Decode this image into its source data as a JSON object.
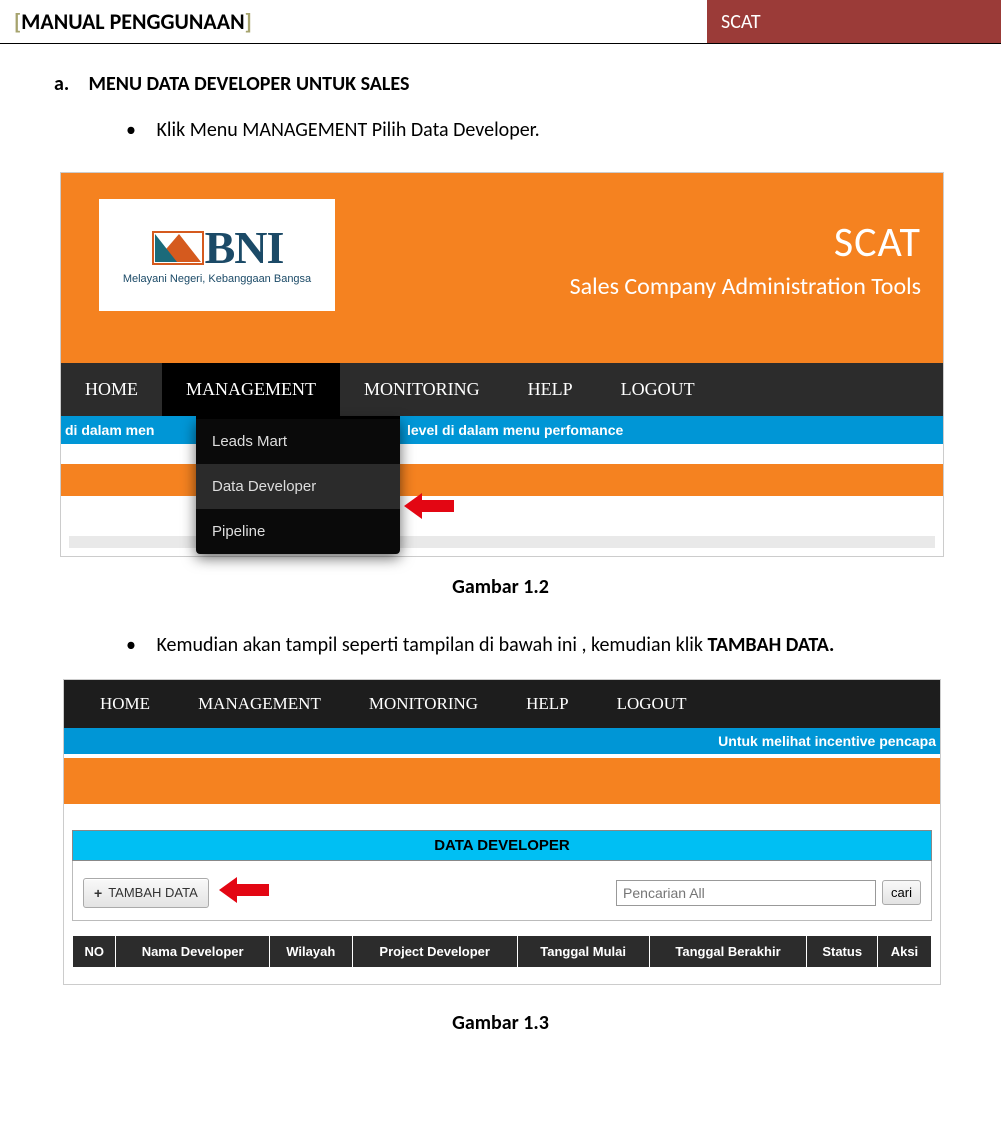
{
  "header": {
    "title": "MANUAL PENGGUNAAN",
    "badge": "SCAT"
  },
  "section": {
    "a_label": "a.",
    "a_title": "MENU DATA DEVELOPER UNTUK SALES",
    "bullet1": "Klik Menu MANAGEMENT Pilih Data Developer.",
    "bullet2_pre": "Kemudian  akan tampil  seperti tampilan di bawah ini , kemudian klik ",
    "bullet2_strong": "TAMBAH DATA."
  },
  "shot1": {
    "bni_tagline": "Melayani Negeri, Kebanggaan Bangsa",
    "bni_text": "BNI",
    "scat_title": "SCAT",
    "scat_sub": "Sales Company Administration Tools",
    "menu": [
      "HOME",
      "MANAGEMENT",
      "MONITORING",
      "HELP",
      "LOGOUT"
    ],
    "strip_left": "di dalam men",
    "strip_right": "level di dalam menu perfomance",
    "dropdown": [
      "Leads Mart",
      "Data Developer",
      "Pipeline"
    ],
    "caption": "Gambar 1.2"
  },
  "shot2": {
    "menu": [
      "HOME",
      "MANAGEMENT",
      "MONITORING",
      "HELP",
      "LOGOUT"
    ],
    "strip": "Untuk melihat incentive pencapa",
    "panel_title": "DATA DEVELOPER",
    "tambah_label": "TAMBAH DATA",
    "search_placeholder": "Pencarian All",
    "cari_label": "cari",
    "columns": [
      "NO",
      "Nama Developer",
      "Wilayah",
      "Project Developer",
      "Tanggal Mulai",
      "Tanggal Berakhir",
      "Status",
      "Aksi"
    ],
    "caption": "Gambar 1.3"
  }
}
